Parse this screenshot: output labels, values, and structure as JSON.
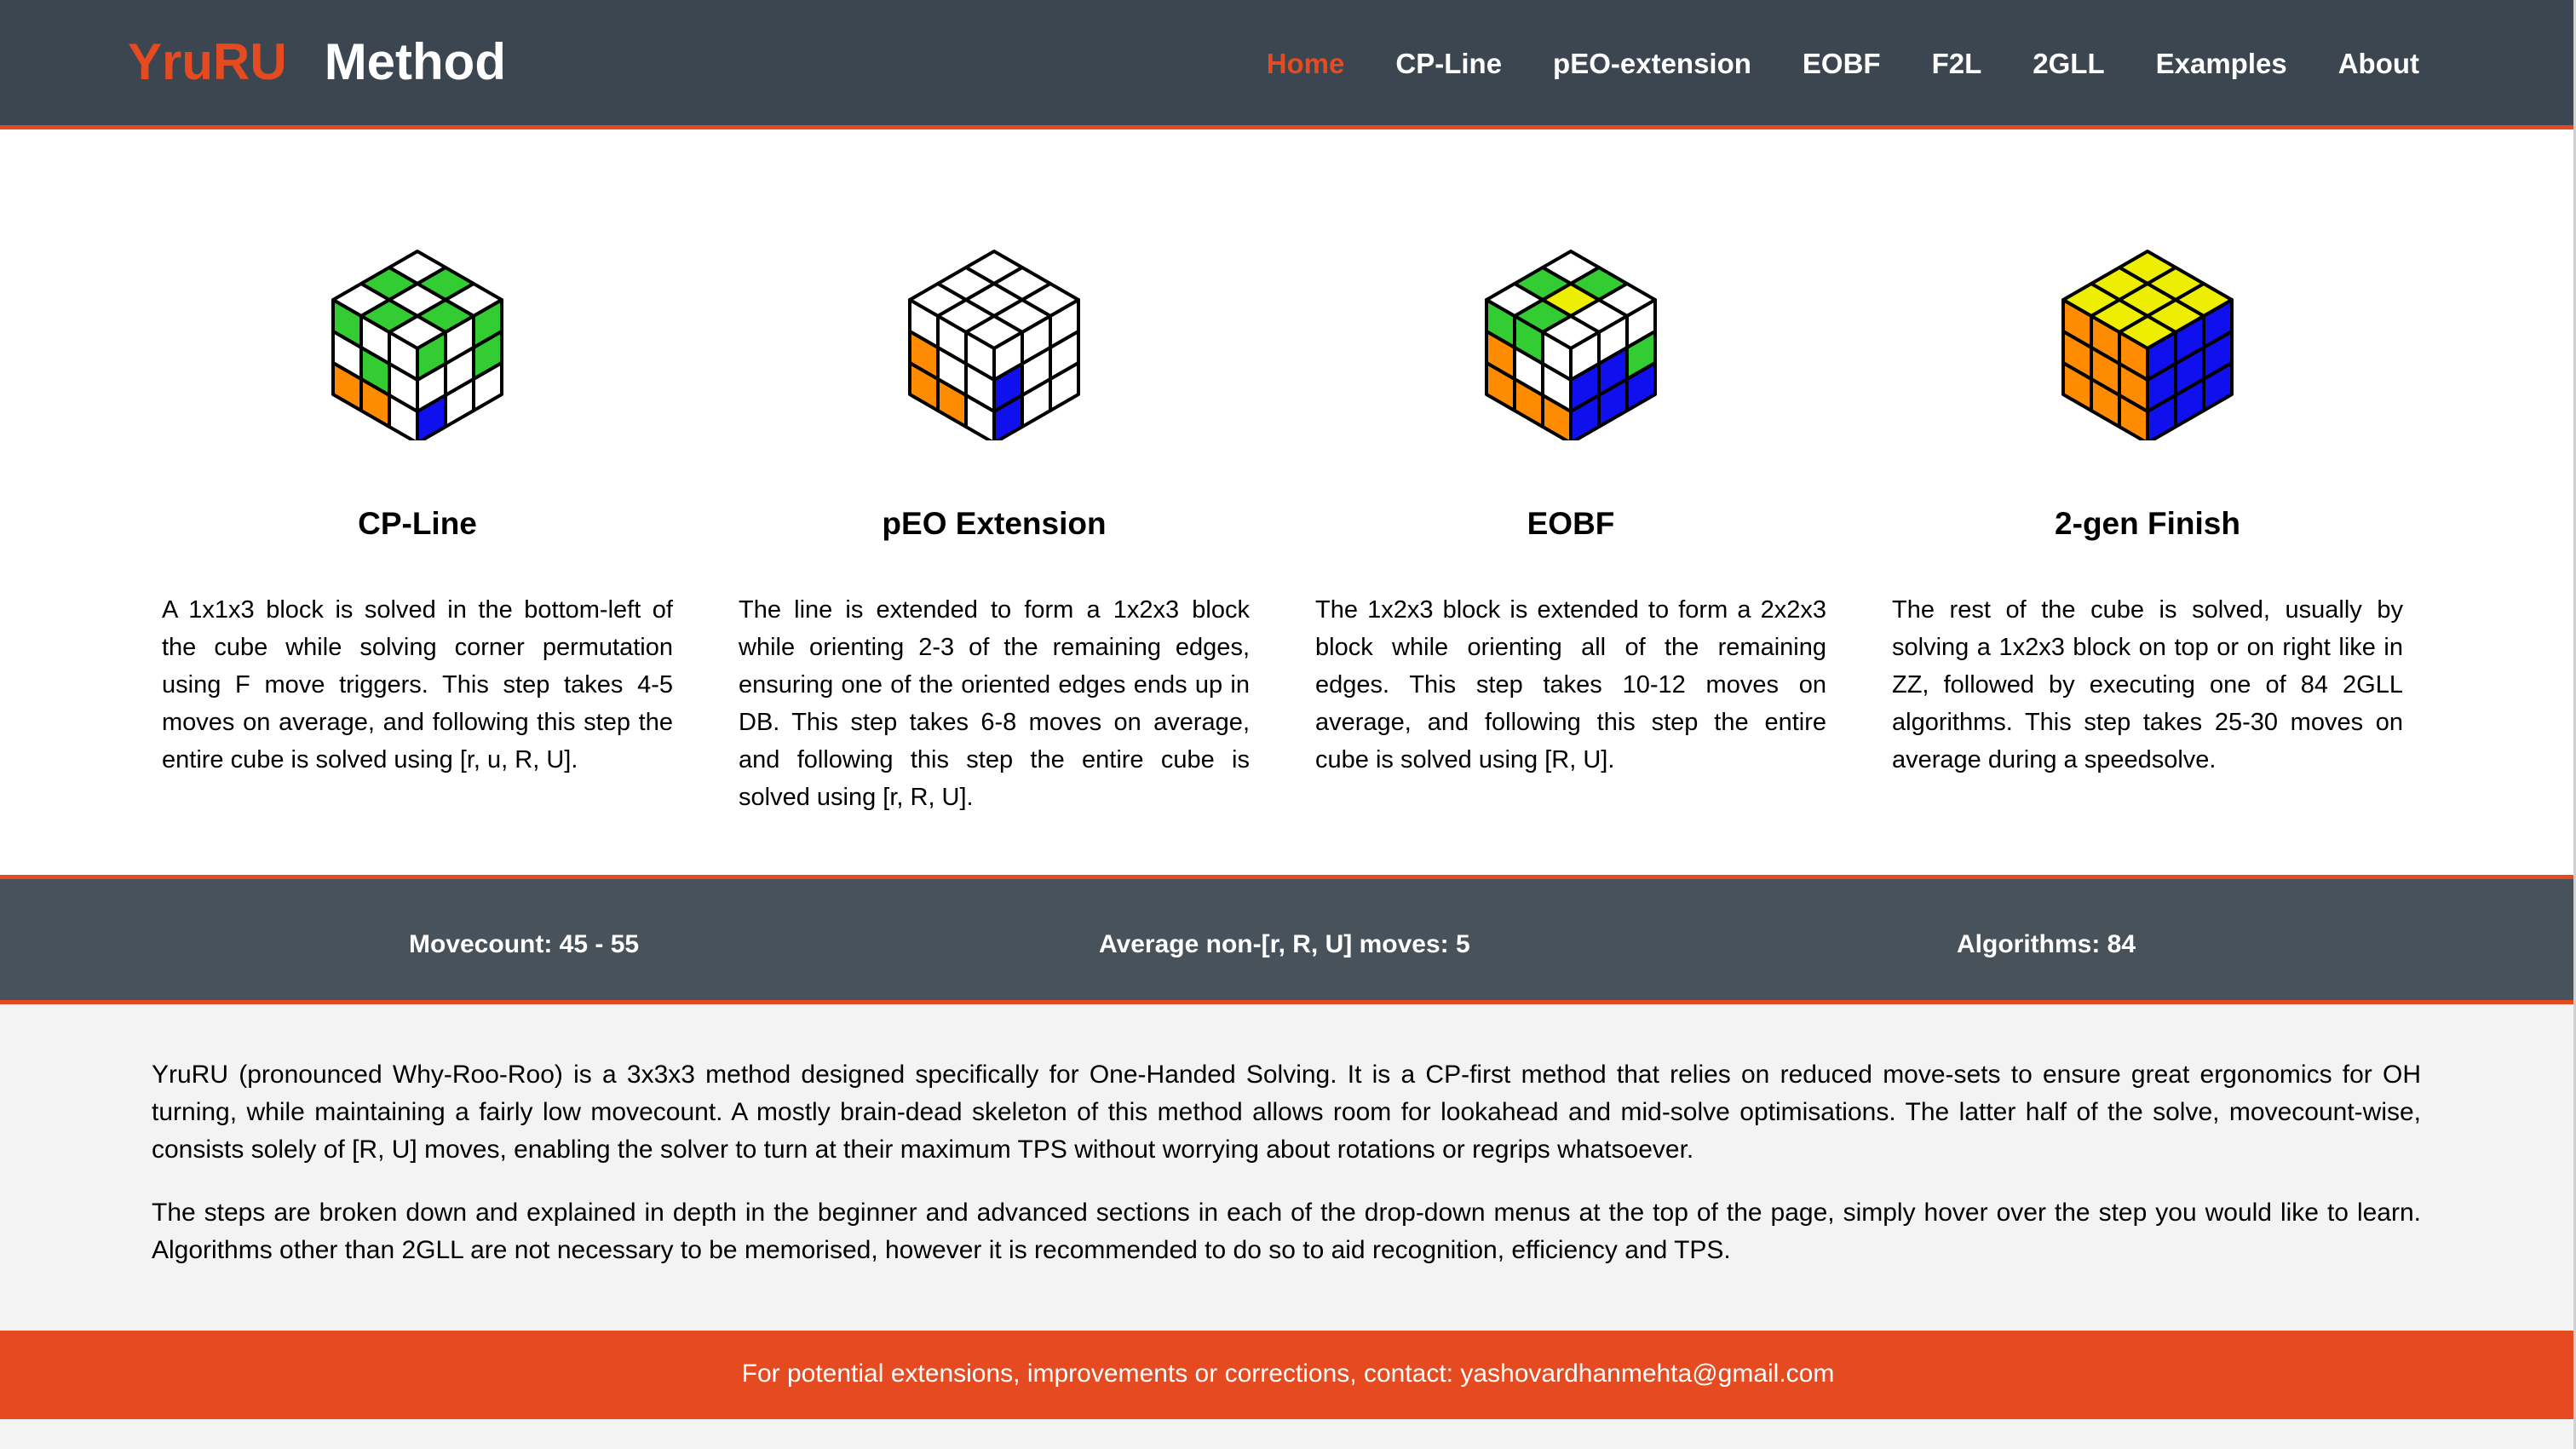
{
  "header": {
    "brand_accent": "YruRU",
    "brand_main": "Method",
    "nav": [
      "Home",
      "CP-Line",
      "pEO-extension",
      "EOBF",
      "F2L",
      "2GLL",
      "Examples",
      "About"
    ],
    "active_nav": "Home"
  },
  "steps": [
    {
      "title": "CP-Line",
      "text": "A 1x1x3 block is solved in the bottom-left of the cube while solving corner permutation using F move triggers. This step takes 4-5 moves on average, and following this step the entire cube is solved using [r, u, R, U].",
      "icon": "cube-cp-line-icon"
    },
    {
      "title": "pEO Extension",
      "text": "The line is extended to form a 1x2x3 block while orienting 2-3 of the remaining edges, ensuring one of the oriented edges ends up in DB. This step takes 6-8 moves on average, and following this step the entire cube is solved using [r, R, U].",
      "icon": "cube-peo-extension-icon"
    },
    {
      "title": "EOBF",
      "text": "The 1x2x3 block is extended to form a 2x2x3 block while orienting all of the remaining edges. This step takes 10-12 moves on average, and following this step the entire cube is solved using [R, U].",
      "icon": "cube-eobf-icon"
    },
    {
      "title": "2-gen Finish",
      "text": "The rest of the cube is solved, usually by solving a 1x2x3 block on top or on right like in ZZ, followed by executing one of 84 2GLL algorithms. This step takes 25-30 moves on average during a speedsolve.",
      "icon": "cube-2gen-finish-icon"
    }
  ],
  "stats": {
    "movecount": "Movecount: 45 - 55",
    "non_ru_moves": "Average non-[r, R, U] moves: 5",
    "algorithms": "Algorithms: 84"
  },
  "intro": {
    "p1": "YruRU (pronounced Why-Roo-Roo) is a 3x3x3 method designed specifically for One-Handed Solving. It is a CP-first method that relies on reduced move-sets to ensure great ergonomics for OH turning, while maintaining a fairly low movecount. A mostly brain-dead skeleton of this method allows room for lookahead and mid-solve optimisations. The latter half of the solve, movecount-wise, consists solely of [R, U] moves, enabling the solver to turn at their maximum TPS without worrying about rotations or regrips whatsoever.",
    "p2": "The steps are broken down and explained in depth in the beginner and advanced sections in each of the drop-down menus at the top of the page, simply hover over the step you would like to learn. Algorithms other than 2GLL are not necessary to be memorised, however it is recommended to do so to aid recognition, efficiency and TPS."
  },
  "footer": {
    "prefix": "For potential extensions, improvements or corrections, contact: ",
    "email": "yashovardhanmehta@gmail.com"
  },
  "colors": {
    "header_bg": "#3b4650",
    "accent": "#e54a20",
    "stats_bg": "#47525b",
    "page_bg": "#f3f3f3",
    "cube_white": "#ffffff",
    "cube_green": "#33cc33",
    "cube_orange": "#ff8c00",
    "cube_blue": "#1010ee",
    "cube_yellow": "#eeee00"
  },
  "cubes": [
    {
      "top": [
        [
          "W",
          "G",
          "W"
        ],
        [
          "G",
          "W",
          "G"
        ],
        [
          "W",
          "G",
          "W"
        ]
      ],
      "left": [
        [
          "G",
          "W",
          "W"
        ],
        [
          "W",
          "G",
          "W"
        ],
        [
          "O",
          "O",
          "W"
        ]
      ],
      "right": [
        [
          "G",
          "W",
          "G"
        ],
        [
          "W",
          "W",
          "G"
        ],
        [
          "B",
          "W",
          "W"
        ]
      ]
    },
    {
      "top": [
        [
          "W",
          "W",
          "W"
        ],
        [
          "W",
          "W",
          "W"
        ],
        [
          "W",
          "W",
          "W"
        ]
      ],
      "left": [
        [
          "W",
          "W",
          "W"
        ],
        [
          "O",
          "W",
          "W"
        ],
        [
          "O",
          "O",
          "W"
        ]
      ],
      "right": [
        [
          "W",
          "W",
          "W"
        ],
        [
          "B",
          "W",
          "W"
        ],
        [
          "B",
          "W",
          "W"
        ]
      ]
    },
    {
      "top": [
        [
          "W",
          "G",
          "W"
        ],
        [
          "G",
          "Y",
          "W"
        ],
        [
          "W",
          "G",
          "W"
        ]
      ],
      "left": [
        [
          "G",
          "G",
          "W"
        ],
        [
          "O",
          "W",
          "W"
        ],
        [
          "O",
          "O",
          "O"
        ]
      ],
      "right": [
        [
          "W",
          "W",
          "W"
        ],
        [
          "B",
          "B",
          "G"
        ],
        [
          "B",
          "B",
          "B"
        ]
      ]
    },
    {
      "top": [
        [
          "Y",
          "Y",
          "Y"
        ],
        [
          "Y",
          "Y",
          "Y"
        ],
        [
          "Y",
          "Y",
          "Y"
        ]
      ],
      "left": [
        [
          "O",
          "O",
          "O"
        ],
        [
          "O",
          "O",
          "O"
        ],
        [
          "O",
          "O",
          "O"
        ]
      ],
      "right": [
        [
          "B",
          "B",
          "B"
        ],
        [
          "B",
          "B",
          "B"
        ],
        [
          "B",
          "B",
          "B"
        ]
      ]
    }
  ]
}
